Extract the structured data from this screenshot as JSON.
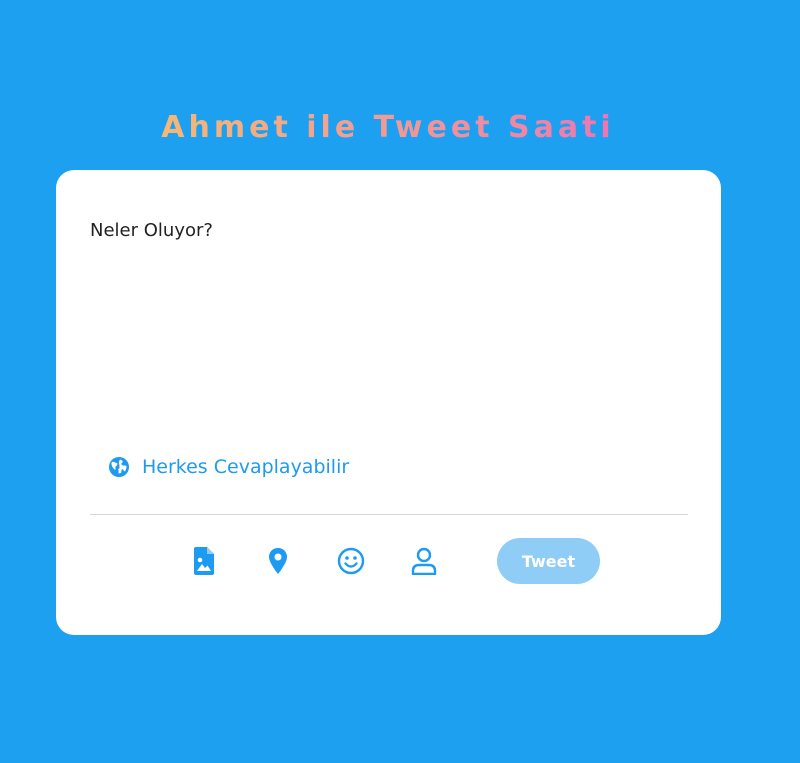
{
  "header": {
    "title": "Ahmet ile Tweet Saati"
  },
  "composer": {
    "placeholder": "Neler Oluyor?",
    "reply_setting_label": "Herkes Cevaplayabilir",
    "tweet_button_label": "Tweet"
  },
  "icons": {
    "globe": "globe-icon",
    "media": "image-file-icon",
    "location": "location-pin-icon",
    "emoji": "smiley-icon",
    "user": "user-icon"
  },
  "colors": {
    "background": "#1da0ef",
    "accent": "#1d9bf0",
    "button_disabled": "#8fcdf7",
    "card": "#ffffff"
  }
}
